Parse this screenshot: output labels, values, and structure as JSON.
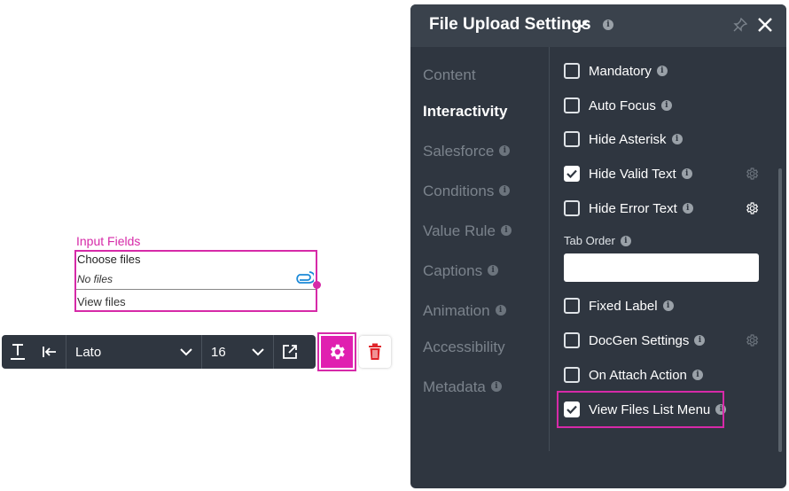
{
  "canvas": {
    "widget_label": "Input Fields",
    "choose_files": "Choose files",
    "no_files": "No files",
    "view_files": "View files"
  },
  "toolbar": {
    "font_value": "Lato",
    "size_value": "16"
  },
  "panel": {
    "title": "File Upload Settings",
    "nav": [
      {
        "label": "Content",
        "info": false,
        "active": false
      },
      {
        "label": "Interactivity",
        "info": false,
        "active": true
      },
      {
        "label": "Salesforce",
        "info": true,
        "active": false
      },
      {
        "label": "Conditions",
        "info": true,
        "active": false
      },
      {
        "label": "Value Rule",
        "info": true,
        "active": false
      },
      {
        "label": "Captions",
        "info": true,
        "active": false
      },
      {
        "label": "Animation",
        "info": true,
        "active": false
      },
      {
        "label": "Accessibility",
        "info": false,
        "active": false
      },
      {
        "label": "Metadata",
        "info": true,
        "active": false
      }
    ],
    "options": [
      {
        "label": "Mandatory",
        "checked": false,
        "gear": false
      },
      {
        "label": "Auto Focus",
        "checked": false,
        "gear": false
      },
      {
        "label": "Hide Asterisk",
        "checked": false,
        "gear": false
      },
      {
        "label": "Hide Valid Text",
        "checked": true,
        "gear": "dim"
      },
      {
        "label": "Hide Error Text",
        "checked": false,
        "gear": "bright"
      },
      {
        "label": "Fixed Label",
        "checked": false,
        "gear": false
      },
      {
        "label": "DocGen Settings",
        "checked": false,
        "gear": "dim"
      },
      {
        "label": "On Attach Action",
        "checked": false,
        "gear": false
      },
      {
        "label": "View Files List Menu",
        "checked": true,
        "gear": false
      }
    ],
    "tab_order_label": "Tab Order",
    "tab_order_value": ""
  },
  "colors": {
    "accent": "#d62aa8",
    "panel_bg": "#2f3640",
    "trash": "#e0242a"
  }
}
